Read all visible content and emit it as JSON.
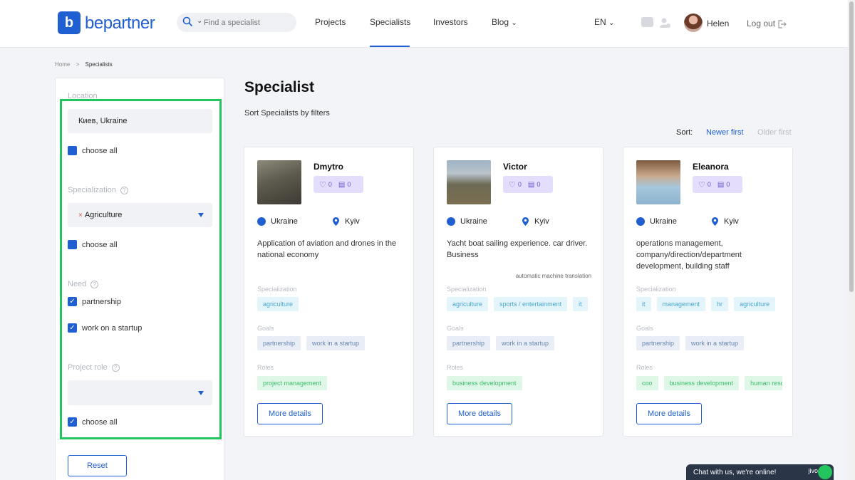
{
  "header": {
    "logo_text": "bepartner",
    "search_placeholder": "Find a specialist",
    "nav": [
      "Projects",
      "Specialists",
      "Investors",
      "Blog"
    ],
    "active_nav": "Specialists",
    "lang": "EN",
    "user_name": "Helen",
    "logout": "Log out"
  },
  "breadcrumb": [
    "Home",
    "Specialists"
  ],
  "sidebar": {
    "location_label": "Location",
    "location_value": "Киев, Ukraine",
    "choose_all": "choose all",
    "specialization_label": "Specialization",
    "specialization_value": "Agriculture",
    "need_label": "Need",
    "need_options": [
      "partnership",
      "work on a startup"
    ],
    "project_role_label": "Project role",
    "reset": "Reset"
  },
  "main": {
    "title": "Specialist",
    "subtitle": "Sort Specialists by filters",
    "sort_label": "Sort:",
    "sort_newer": "Newer first",
    "sort_older": "Older first"
  },
  "labels": {
    "specialization": "Specialization",
    "goals": "Goals",
    "roles": "Roles",
    "more": "More details"
  },
  "cards": [
    {
      "name": "Dmytro",
      "likes": "0",
      "messages": "0",
      "country": "Ukraine",
      "city": "Kyiv",
      "description": "Application of aviation and drones in the national economy",
      "note": "",
      "specializations": [
        "agriculture"
      ],
      "goals": [
        "partnership",
        "work in a startup"
      ],
      "roles": [
        "project management"
      ]
    },
    {
      "name": "Victor",
      "likes": "0",
      "messages": "0",
      "country": "Ukraine",
      "city": "Kyiv",
      "description": "Yacht boat sailing experience. car driver. Business",
      "note": "automatic machine translation",
      "specializations": [
        "agriculture",
        "sports / entertainment",
        "it"
      ],
      "goals": [
        "partnership",
        "work in a startup"
      ],
      "roles": [
        "business development"
      ]
    },
    {
      "name": "Eleanora",
      "likes": "0",
      "messages": "0",
      "country": "Ukraine",
      "city": "Kyiv",
      "description": "operations management, company/direction/department development, building staff",
      "note": "",
      "specializations": [
        "it",
        "management",
        "hr",
        "agriculture"
      ],
      "goals": [
        "partnership",
        "work in a startup"
      ],
      "roles": [
        "coo",
        "business development",
        "human resources"
      ]
    }
  ],
  "chat": {
    "text": "Chat with us, we're online!",
    "brand": "jivo"
  },
  "colors": {
    "brand": "#1f5fd1",
    "highlight": "#22c55e"
  }
}
